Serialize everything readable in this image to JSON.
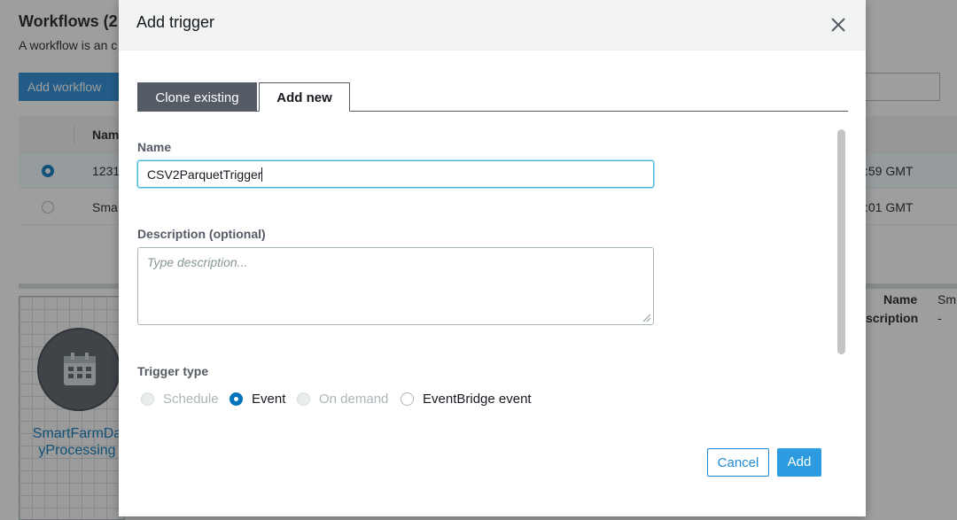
{
  "background": {
    "title": "Workflows (2",
    "subtitle": "A workflow is an c",
    "add_workflow": "Add workflow",
    "column_name": "Nam",
    "rows": [
      {
        "name": "1231",
        "date": ":59 GMT",
        "selected": true
      },
      {
        "name": "Sma",
        "date": ":01 GMT",
        "selected": false
      }
    ],
    "node_label_1": "SmartFarmDa",
    "node_label_2": "yProcessing",
    "detail_name_label": "Name",
    "detail_name_value": "Sm",
    "detail_desc_label": "scription",
    "detail_desc_value": "-"
  },
  "modal": {
    "title": "Add trigger",
    "tabs": [
      {
        "label": "Clone existing",
        "active": false
      },
      {
        "label": "Add new",
        "active": true
      }
    ],
    "name_label": "Name",
    "name_value": "CSV2ParquetTrigger",
    "description_label": "Description (optional)",
    "description_placeholder": "Type description...",
    "trigger_type_label": "Trigger type",
    "trigger_options": [
      {
        "label": "Schedule",
        "state": "disabled"
      },
      {
        "label": "Event",
        "state": "selected"
      },
      {
        "label": "On demand",
        "state": "disabled"
      },
      {
        "label": "EventBridge event",
        "state": "enabled"
      }
    ],
    "cancel_label": "Cancel",
    "add_label": "Add"
  },
  "colors": {
    "primary": "#1e88d4",
    "radio_selected": "#0073bb",
    "focus_border": "#44b9d6",
    "tab_inactive": "#545b64"
  },
  "icons": [
    "close-icon",
    "calendar-icon",
    "resize-handle-icon"
  ]
}
